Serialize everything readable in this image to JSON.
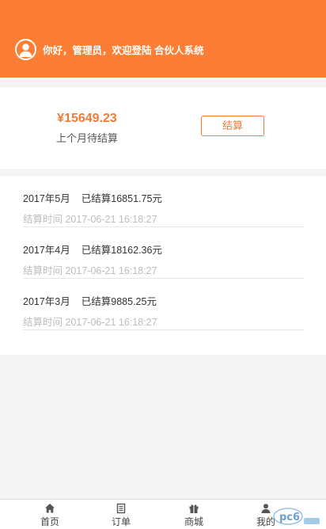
{
  "header": {
    "greeting": "你好，管理员，欢迎登陆 合伙人系统",
    "bg_color": "#fb7e34"
  },
  "summary": {
    "amount": "¥15649.23",
    "amount_label": "上个月待结算",
    "settle_button": "结算",
    "accent_color": "#f47a37"
  },
  "records": [
    {
      "month": "2017年5月",
      "settled": "已结算16851.75元",
      "time": "结算时间 2017-06-21 16:18:27"
    },
    {
      "month": "2017年4月",
      "settled": "已结算18162.36元",
      "time": "结算时间 2017-06-21 16:18:27"
    },
    {
      "month": "2017年3月",
      "settled": "已结算9885.25元",
      "time": "结算时间 2017-06-21 16:18:27"
    }
  ],
  "tabbar": {
    "items": [
      {
        "label": "首页",
        "icon": "home-icon"
      },
      {
        "label": "订单",
        "icon": "order-list-icon"
      },
      {
        "label": "商城",
        "icon": "gift-icon"
      },
      {
        "label": "我的",
        "icon": "user-icon"
      }
    ]
  }
}
